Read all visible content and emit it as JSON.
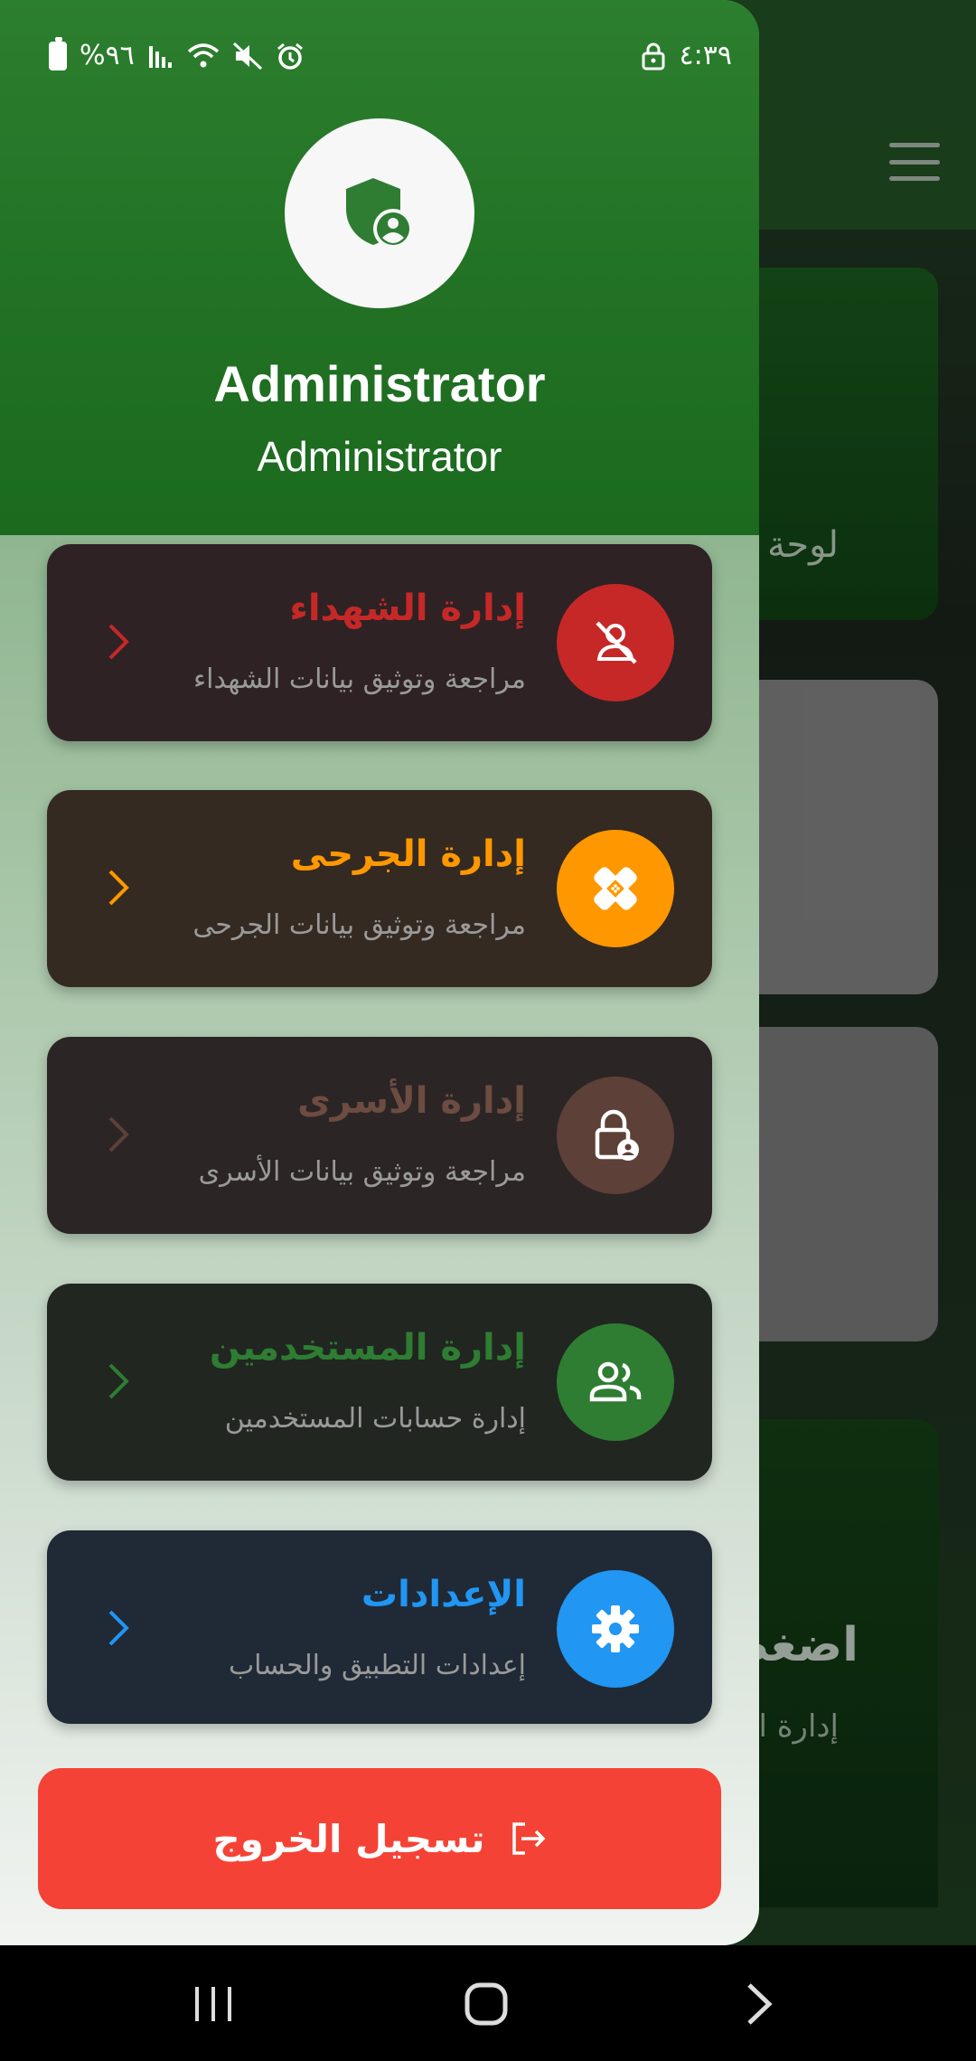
{
  "status_bar": {
    "time": "٤:٣٩",
    "battery": "%٩٦"
  },
  "background": {
    "card1_text": "لوحة",
    "card4_title": "اضغط",
    "card4_sub": "إدارة الش"
  },
  "drawer": {
    "user_name": "Administrator",
    "user_role": "Administrator",
    "menu": [
      {
        "title": "إدارة الشهداء",
        "subtitle": "مراجعة وتوثيق بيانات الشهداء",
        "color": "#c62828",
        "title_color": "#c62828",
        "bg": "#2e2224",
        "icon": "person-off-icon"
      },
      {
        "title": "إدارة الجرحى",
        "subtitle": "مراجعة وتوثيق بيانات الجرحى",
        "color": "#ff9800",
        "title_color": "#ff9800",
        "bg": "#352a21",
        "icon": "bandage-icon"
      },
      {
        "title": "إدارة الأسرى",
        "subtitle": "مراجعة وتوثيق بيانات الأسرى",
        "color": "#5d4037",
        "title_color": "#6d4c41",
        "bg": "#2c2526",
        "icon": "lock-person-icon"
      },
      {
        "title": "إدارة المستخدمين",
        "subtitle": "إدارة حسابات المستخدمين",
        "color": "#2e7d32",
        "title_color": "#2e7d32",
        "bg": "#212621",
        "icon": "people-icon"
      },
      {
        "title": "الإعدادات",
        "subtitle": "إعدادات التطبيق والحساب",
        "color": "#2196f3",
        "title_color": "#2196f3",
        "bg": "#1f2a36",
        "icon": "gear-icon"
      }
    ],
    "logout_label": "تسجيل الخروج"
  }
}
